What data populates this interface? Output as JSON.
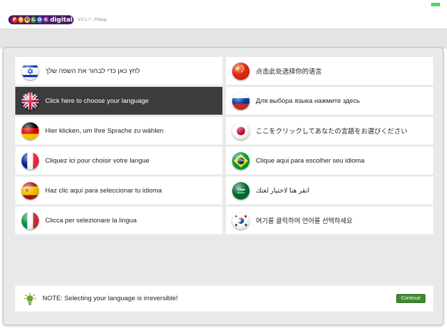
{
  "app": {
    "logo_letters": [
      "P",
      "R",
      "O",
      "L",
      "O",
      "G"
    ],
    "logo_word": "digital",
    "version": "V.0.1.7 - Prolog"
  },
  "colors": {
    "selected_bg": "#3c3c3c",
    "continue_green": "#3f8b2e",
    "logo_purple": "#4a1c5e"
  },
  "languages": [
    {
      "flag": "israel-flag-icon",
      "label": "לחץ כאן כדי לבחור את השפה שלך"
    },
    {
      "flag": "china-flag-icon",
      "label": "点击此处选择你的语言"
    },
    {
      "flag": "uk-flag-icon",
      "label": "Click here to choose your language",
      "selected": true
    },
    {
      "flag": "russia-flag-icon",
      "label": "Для выбора языка нажмите здесь"
    },
    {
      "flag": "germany-flag-icon",
      "label": "Hier klicken, um Ihre Sprache zu wählen"
    },
    {
      "flag": "japan-flag-icon",
      "label": "ここをクリックしてあなたの言語をお選びください"
    },
    {
      "flag": "france-flag-icon",
      "label": "Cliquez ici pour choisir votre langue"
    },
    {
      "flag": "brazil-flag-icon",
      "label": "Clique aqui para escolher seu idioma"
    },
    {
      "flag": "spain-flag-icon",
      "label": "Haz clic aquí para seleccionar tu idioma"
    },
    {
      "flag": "saudi-arabia-flag-icon",
      "label": "انقر هنا لاختيار لغتك"
    },
    {
      "flag": "italy-flag-icon",
      "label": "Clicca per selezionare la lingua"
    },
    {
      "flag": "south-korea-flag-icon",
      "label": "여기를 클릭하여 언어를 선택하세요"
    }
  ],
  "footer": {
    "note": "NOTE: Selecting your language is irreversible!",
    "continue_label": "Continue",
    "bulb_icon": "lightbulb-icon"
  }
}
